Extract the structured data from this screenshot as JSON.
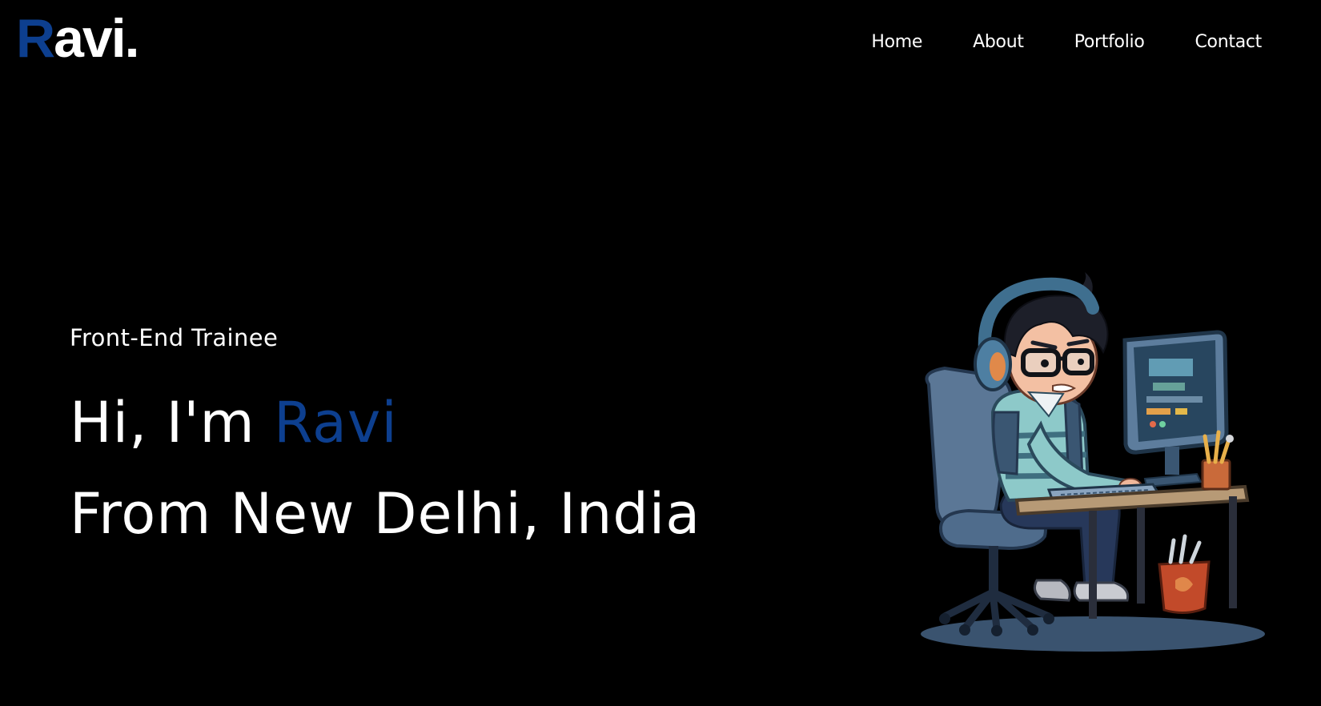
{
  "brand": {
    "initial": "R",
    "rest": "avi."
  },
  "nav": {
    "items": [
      "Home",
      "About",
      "Portfolio",
      "Contact"
    ]
  },
  "hero": {
    "role": "Front-End Trainee",
    "greeting": "Hi, I'm",
    "name": "Ravi",
    "location_line": "From New Delhi, India"
  },
  "colors": {
    "background": "#000000",
    "text": "#ffffff",
    "accent": "#0d3f8f"
  }
}
